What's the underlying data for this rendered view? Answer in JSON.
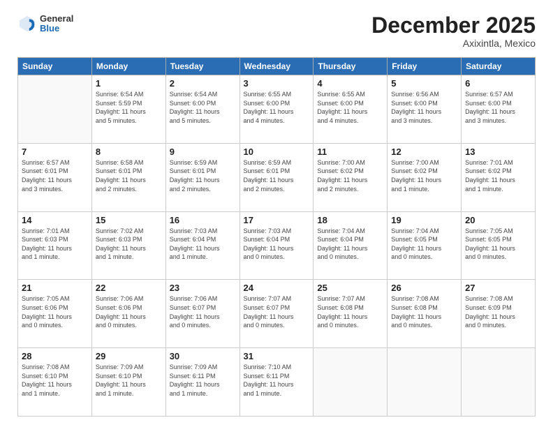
{
  "header": {
    "logo": {
      "general": "General",
      "blue": "Blue"
    },
    "title": "December 2025",
    "subtitle": "Axixintla, Mexico"
  },
  "calendar": {
    "headers": [
      "Sunday",
      "Monday",
      "Tuesday",
      "Wednesday",
      "Thursday",
      "Friday",
      "Saturday"
    ],
    "weeks": [
      [
        {
          "day": "",
          "info": ""
        },
        {
          "day": "1",
          "info": "Sunrise: 6:54 AM\nSunset: 5:59 PM\nDaylight: 11 hours\nand 5 minutes."
        },
        {
          "day": "2",
          "info": "Sunrise: 6:54 AM\nSunset: 6:00 PM\nDaylight: 11 hours\nand 5 minutes."
        },
        {
          "day": "3",
          "info": "Sunrise: 6:55 AM\nSunset: 6:00 PM\nDaylight: 11 hours\nand 4 minutes."
        },
        {
          "day": "4",
          "info": "Sunrise: 6:55 AM\nSunset: 6:00 PM\nDaylight: 11 hours\nand 4 minutes."
        },
        {
          "day": "5",
          "info": "Sunrise: 6:56 AM\nSunset: 6:00 PM\nDaylight: 11 hours\nand 3 minutes."
        },
        {
          "day": "6",
          "info": "Sunrise: 6:57 AM\nSunset: 6:00 PM\nDaylight: 11 hours\nand 3 minutes."
        }
      ],
      [
        {
          "day": "7",
          "info": "Sunrise: 6:57 AM\nSunset: 6:01 PM\nDaylight: 11 hours\nand 3 minutes."
        },
        {
          "day": "8",
          "info": "Sunrise: 6:58 AM\nSunset: 6:01 PM\nDaylight: 11 hours\nand 2 minutes."
        },
        {
          "day": "9",
          "info": "Sunrise: 6:59 AM\nSunset: 6:01 PM\nDaylight: 11 hours\nand 2 minutes."
        },
        {
          "day": "10",
          "info": "Sunrise: 6:59 AM\nSunset: 6:01 PM\nDaylight: 11 hours\nand 2 minutes."
        },
        {
          "day": "11",
          "info": "Sunrise: 7:00 AM\nSunset: 6:02 PM\nDaylight: 11 hours\nand 2 minutes."
        },
        {
          "day": "12",
          "info": "Sunrise: 7:00 AM\nSunset: 6:02 PM\nDaylight: 11 hours\nand 1 minute."
        },
        {
          "day": "13",
          "info": "Sunrise: 7:01 AM\nSunset: 6:02 PM\nDaylight: 11 hours\nand 1 minute."
        }
      ],
      [
        {
          "day": "14",
          "info": "Sunrise: 7:01 AM\nSunset: 6:03 PM\nDaylight: 11 hours\nand 1 minute."
        },
        {
          "day": "15",
          "info": "Sunrise: 7:02 AM\nSunset: 6:03 PM\nDaylight: 11 hours\nand 1 minute."
        },
        {
          "day": "16",
          "info": "Sunrise: 7:03 AM\nSunset: 6:04 PM\nDaylight: 11 hours\nand 1 minute."
        },
        {
          "day": "17",
          "info": "Sunrise: 7:03 AM\nSunset: 6:04 PM\nDaylight: 11 hours\nand 0 minutes."
        },
        {
          "day": "18",
          "info": "Sunrise: 7:04 AM\nSunset: 6:04 PM\nDaylight: 11 hours\nand 0 minutes."
        },
        {
          "day": "19",
          "info": "Sunrise: 7:04 AM\nSunset: 6:05 PM\nDaylight: 11 hours\nand 0 minutes."
        },
        {
          "day": "20",
          "info": "Sunrise: 7:05 AM\nSunset: 6:05 PM\nDaylight: 11 hours\nand 0 minutes."
        }
      ],
      [
        {
          "day": "21",
          "info": "Sunrise: 7:05 AM\nSunset: 6:06 PM\nDaylight: 11 hours\nand 0 minutes."
        },
        {
          "day": "22",
          "info": "Sunrise: 7:06 AM\nSunset: 6:06 PM\nDaylight: 11 hours\nand 0 minutes."
        },
        {
          "day": "23",
          "info": "Sunrise: 7:06 AM\nSunset: 6:07 PM\nDaylight: 11 hours\nand 0 minutes."
        },
        {
          "day": "24",
          "info": "Sunrise: 7:07 AM\nSunset: 6:07 PM\nDaylight: 11 hours\nand 0 minutes."
        },
        {
          "day": "25",
          "info": "Sunrise: 7:07 AM\nSunset: 6:08 PM\nDaylight: 11 hours\nand 0 minutes."
        },
        {
          "day": "26",
          "info": "Sunrise: 7:08 AM\nSunset: 6:08 PM\nDaylight: 11 hours\nand 0 minutes."
        },
        {
          "day": "27",
          "info": "Sunrise: 7:08 AM\nSunset: 6:09 PM\nDaylight: 11 hours\nand 0 minutes."
        }
      ],
      [
        {
          "day": "28",
          "info": "Sunrise: 7:08 AM\nSunset: 6:10 PM\nDaylight: 11 hours\nand 1 minute."
        },
        {
          "day": "29",
          "info": "Sunrise: 7:09 AM\nSunset: 6:10 PM\nDaylight: 11 hours\nand 1 minute."
        },
        {
          "day": "30",
          "info": "Sunrise: 7:09 AM\nSunset: 6:11 PM\nDaylight: 11 hours\nand 1 minute."
        },
        {
          "day": "31",
          "info": "Sunrise: 7:10 AM\nSunset: 6:11 PM\nDaylight: 11 hours\nand 1 minute."
        },
        {
          "day": "",
          "info": ""
        },
        {
          "day": "",
          "info": ""
        },
        {
          "day": "",
          "info": ""
        }
      ]
    ]
  }
}
